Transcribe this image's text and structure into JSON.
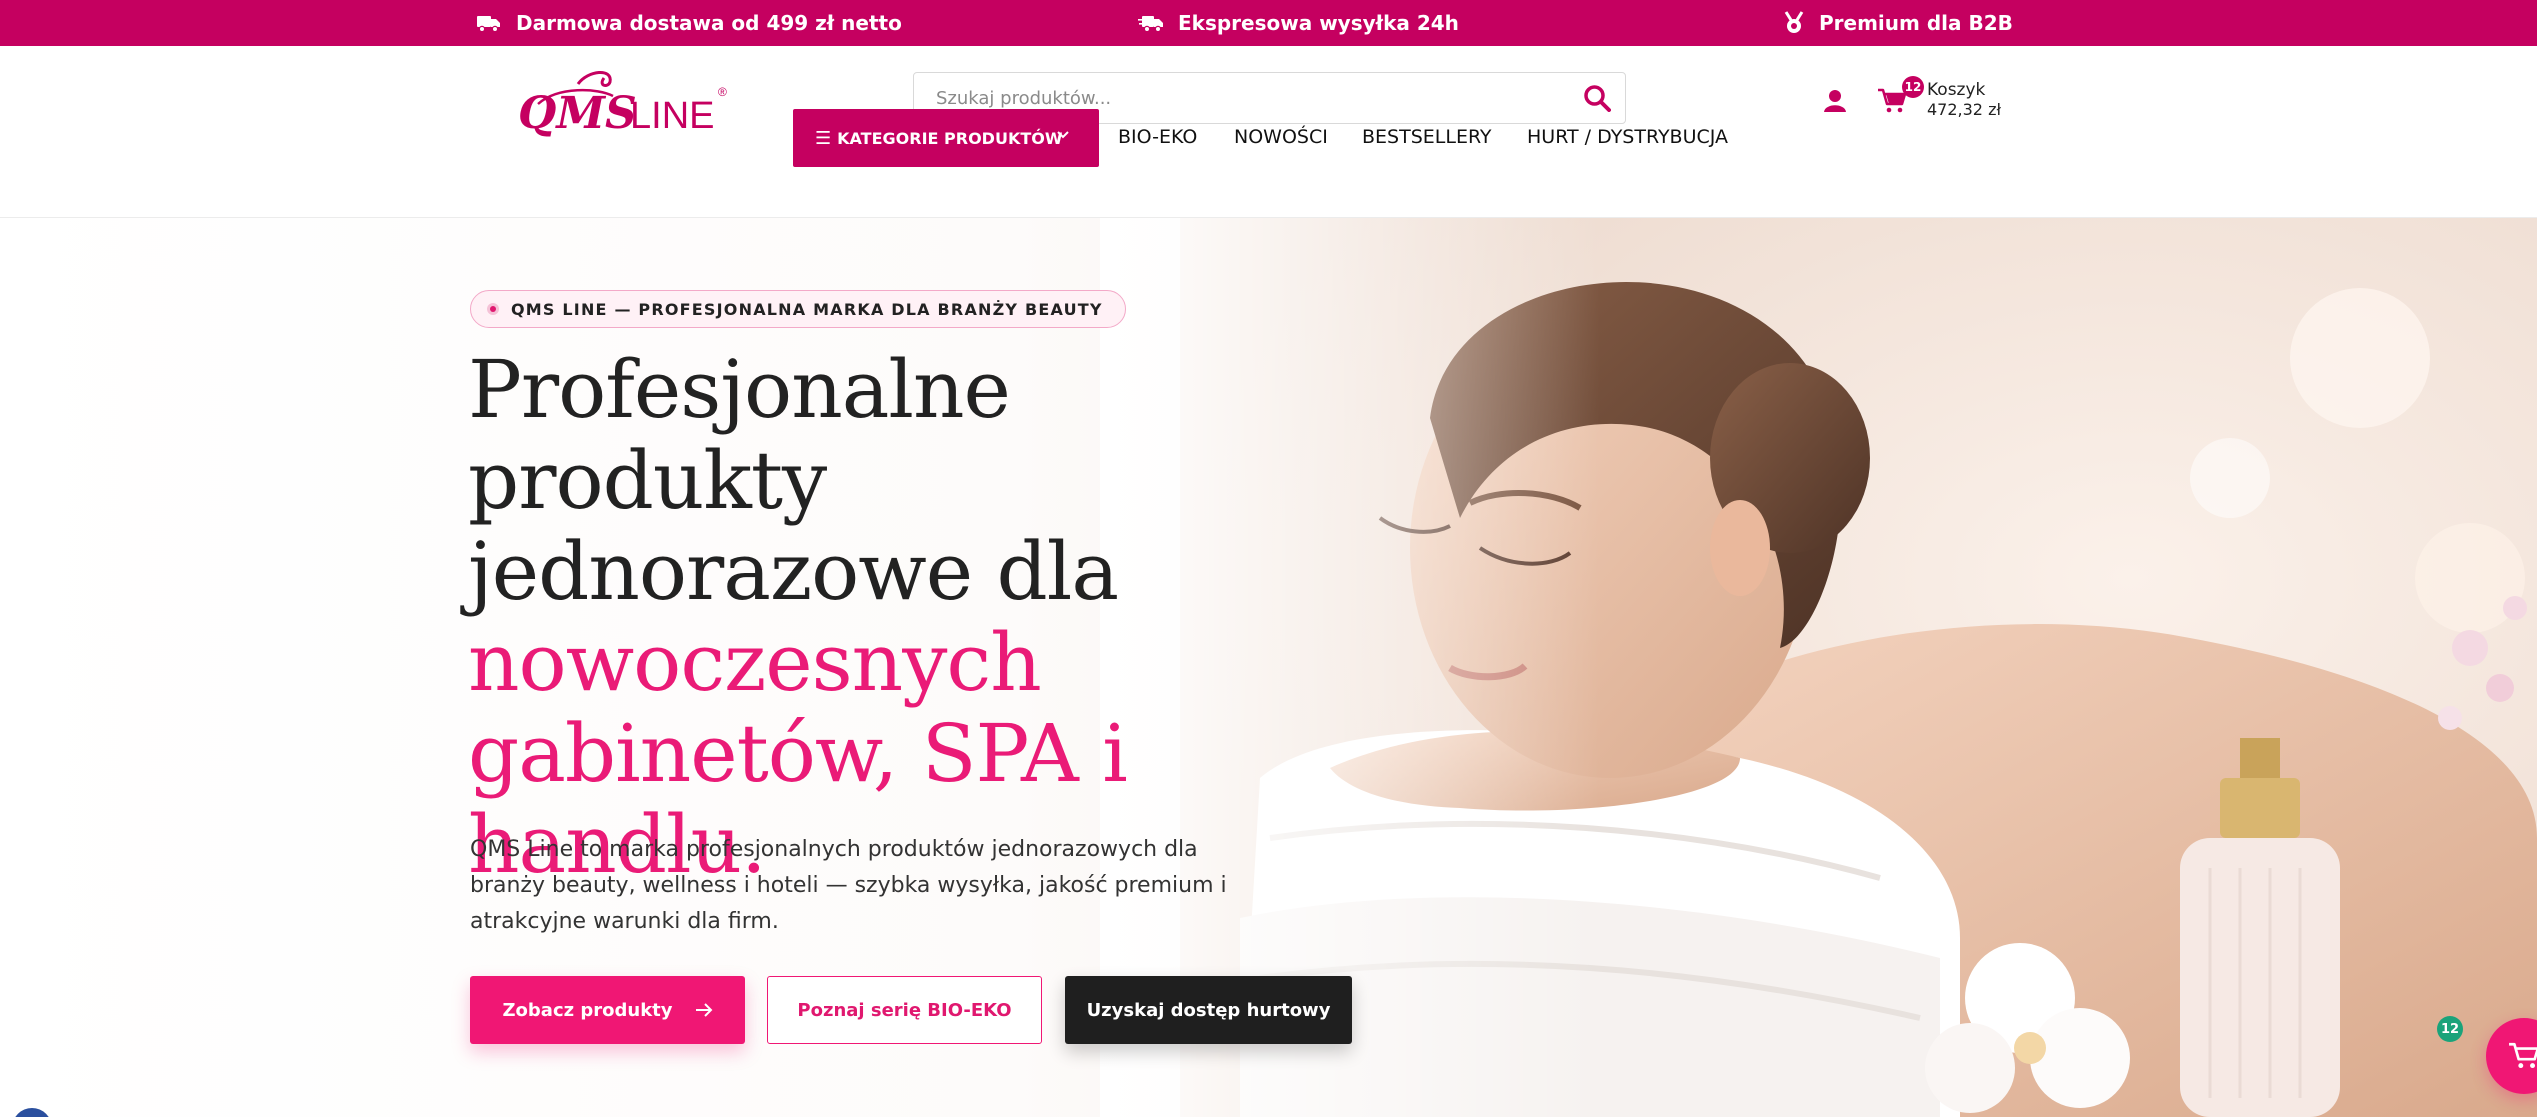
{
  "topbar": {
    "bg_color": "#c50060",
    "items": [
      {
        "icon": "delivery-truck-icon",
        "text": "Darmowa dostawa od 499 zł netto"
      },
      {
        "icon": "fast-truck-icon",
        "text": "Ekspresowa wysyłka 24h"
      },
      {
        "icon": "medal-icon",
        "text": "Premium dla B2B"
      }
    ]
  },
  "header": {
    "logo": {
      "text": "QMS LINE",
      "mark": "®"
    },
    "search": {
      "placeholder": "Szukaj produktów...",
      "icon": "search-icon"
    },
    "account_icon": "user-icon",
    "cart": {
      "badge": "12",
      "label": "Koszyk",
      "total": "472,32 zł",
      "icon": "cart-icon"
    }
  },
  "nav": {
    "categories_label": "KATEGORIE PRODUKTÓW",
    "links": [
      "BIO-EKO",
      "NOWOŚCI",
      "BESTSELLERY",
      "HURT / DYSTRYBUCJA"
    ]
  },
  "hero": {
    "eyebrow": "QMS LINE — PROFESJONALNA MARKA DLA BRANŻY BEAUTY",
    "title_dark": [
      "Profesjonalne produkty",
      "jednorazowe dla"
    ],
    "title_pink": [
      "nowoczesnych",
      "gabinetów, SPA i",
      "handlu."
    ],
    "lead": "QMS Line to marka profesjonalnych produktów jednorazowych dla branży beauty, wellness i hoteli — szybka wysyłka, jakość premium i atrakcyjne warunki dla firm.",
    "buttons": {
      "primary": "Zobacz produkty",
      "secondary": "Poznaj serię BIO-EKO",
      "dark": "Uzyskaj dostęp hurtowy"
    }
  },
  "floating_cart": {
    "badge": "12",
    "icon": "cart-icon"
  },
  "colors": {
    "brand": "#c50060",
    "accent": "#f01774",
    "dark": "#1f1f1f",
    "badge_green": "#1aa37a"
  }
}
